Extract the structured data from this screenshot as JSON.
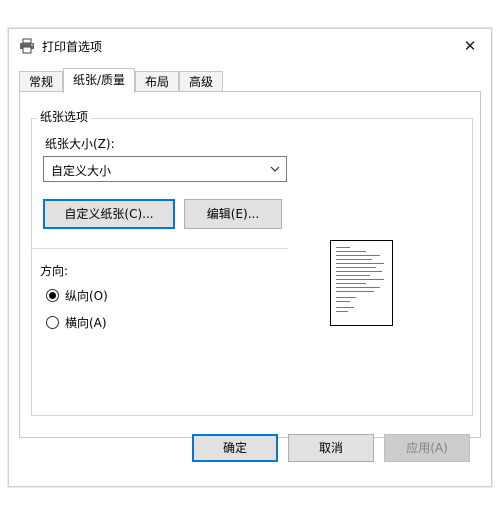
{
  "window": {
    "title": "打印首选项",
    "close_glyph": "✕"
  },
  "tabs": [
    {
      "label": "常规",
      "active": false
    },
    {
      "label": "纸张/质量",
      "active": true
    },
    {
      "label": "布局",
      "active": false
    },
    {
      "label": "高级",
      "active": false
    }
  ],
  "paper_options": {
    "group_title": "纸张选项",
    "size_label": "纸张大小(Z):",
    "size_selected": "自定义大小",
    "custom_paper_button": "自定义纸张(C)...",
    "edit_button": "编辑(E)..."
  },
  "orientation": {
    "label": "方向:",
    "portrait": {
      "label": "纵向(O)",
      "checked": true
    },
    "landscape": {
      "label": "横向(A)",
      "checked": false
    }
  },
  "footer": {
    "ok": "确定",
    "cancel": "取消",
    "apply": "应用(A)"
  },
  "colors": {
    "focus_accent": "#0078d7",
    "button_face": "#e1e1e1"
  }
}
